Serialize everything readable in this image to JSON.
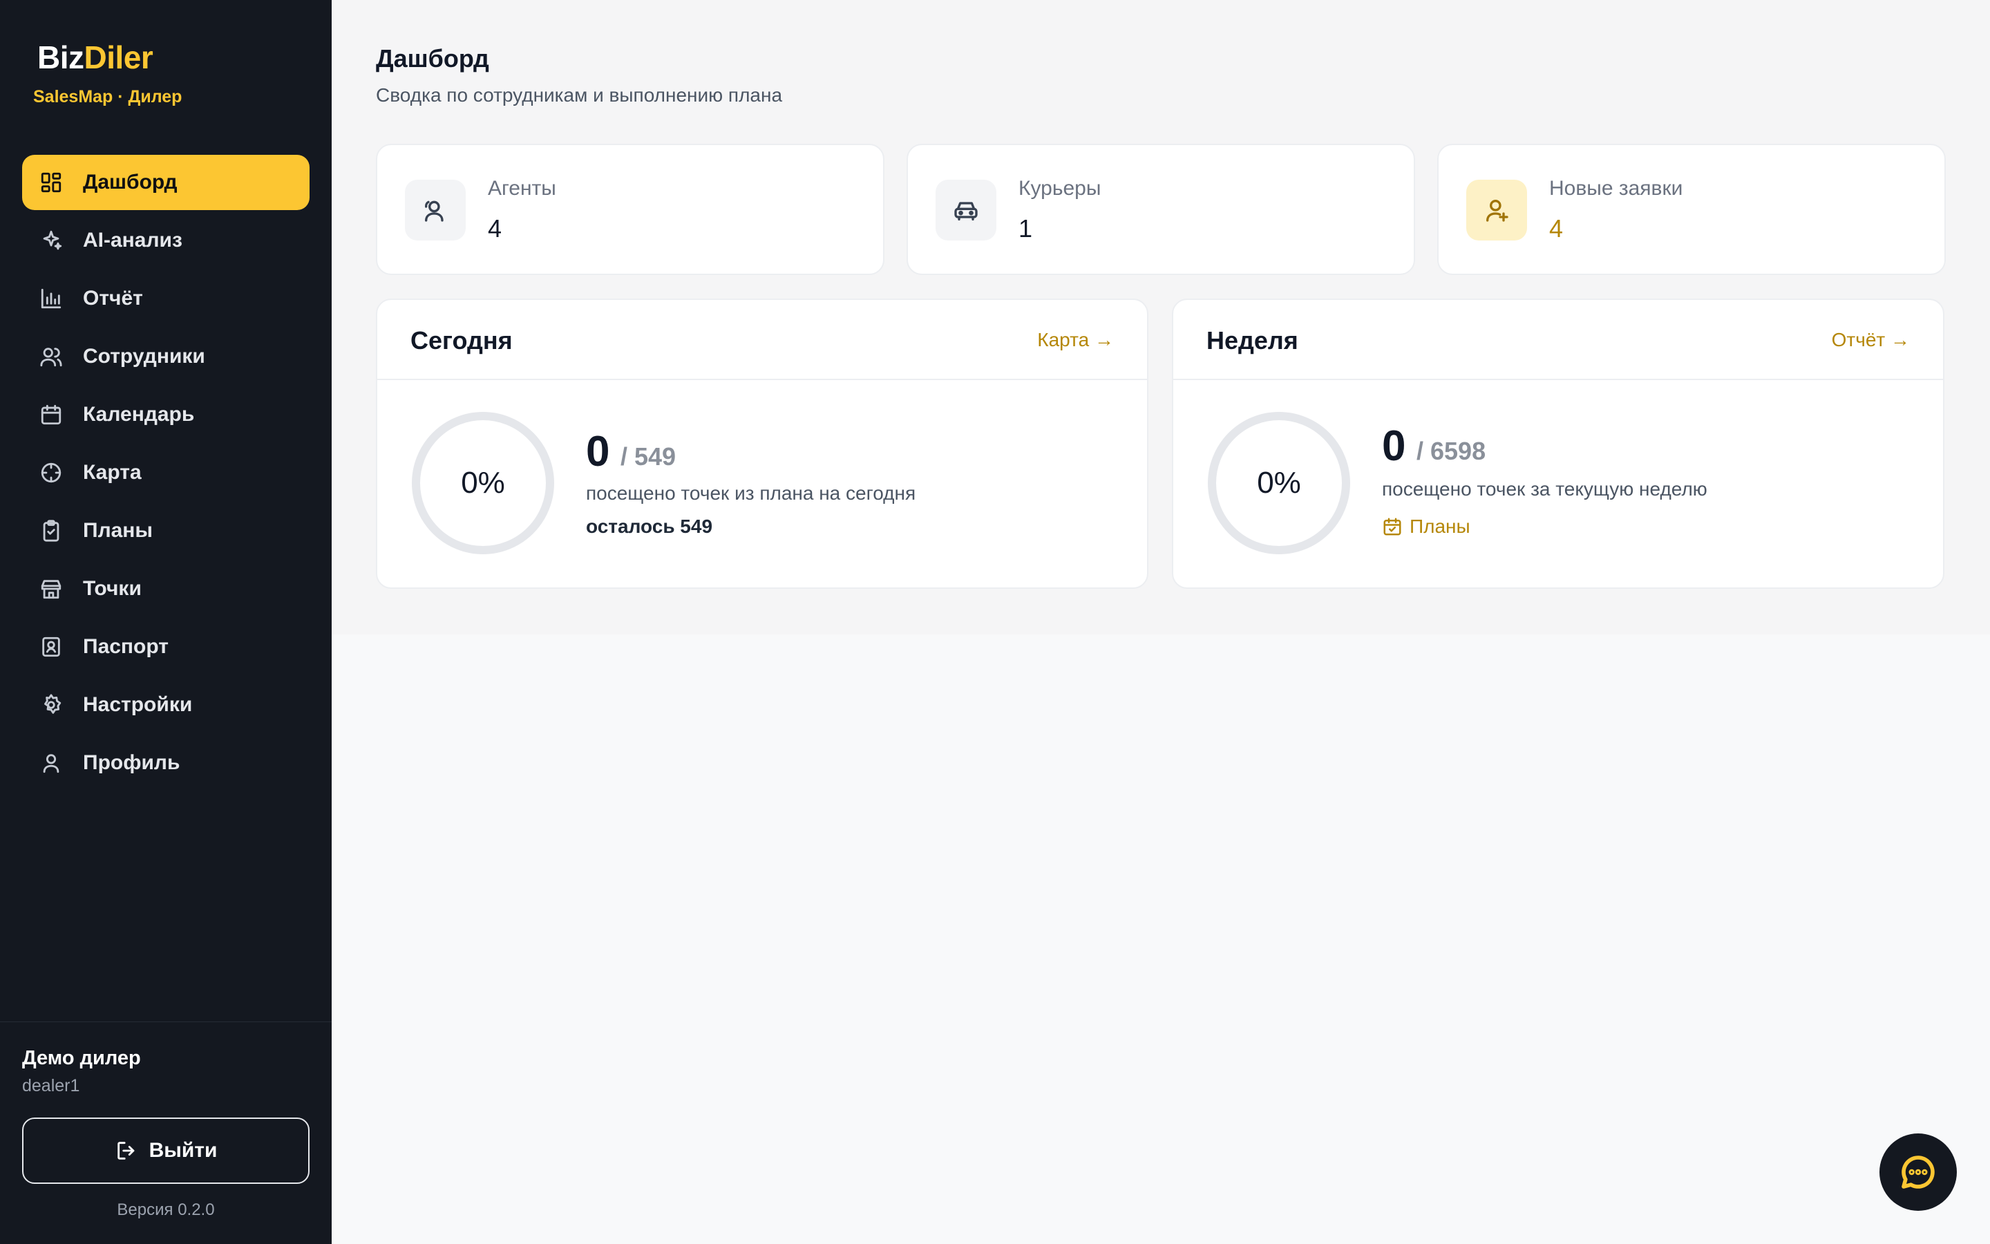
{
  "sidebar": {
    "brand_part1": "Biz",
    "brand_part2": "Diler",
    "brand_sub": "SalesMap · Дилер",
    "items": [
      {
        "label": "Дашборд",
        "icon": "dashboard-icon",
        "active": true
      },
      {
        "label": "AI-анализ",
        "icon": "sparkle-icon"
      },
      {
        "label": "Отчёт",
        "icon": "bar-chart-icon"
      },
      {
        "label": "Сотрудники",
        "icon": "users-icon"
      },
      {
        "label": "Календарь",
        "icon": "calendar-icon"
      },
      {
        "label": "Карта",
        "icon": "crosshair-icon"
      },
      {
        "label": "Планы",
        "icon": "clipboard-check-icon"
      },
      {
        "label": "Точки",
        "icon": "store-icon"
      },
      {
        "label": "Паспорт",
        "icon": "id-card-icon"
      },
      {
        "label": "Настройки",
        "icon": "gear-icon"
      },
      {
        "label": "Профиль",
        "icon": "user-icon"
      }
    ],
    "user_name": "Демо дилер",
    "user_login": "dealer1",
    "logout_label": "Выйти",
    "version": "Версия 0.2.0"
  },
  "header": {
    "title": "Дашборд",
    "subtitle": "Сводка по сотрудникам и выполнению плана"
  },
  "stats": [
    {
      "label": "Агенты",
      "value": "4",
      "icon": "agents-icon"
    },
    {
      "label": "Курьеры",
      "value": "1",
      "icon": "car-icon"
    },
    {
      "label": "Новые заявки",
      "value": "4",
      "icon": "user-plus-icon",
      "accent": "#b58708"
    }
  ],
  "today": {
    "title": "Сегодня",
    "link": "Карта →",
    "percent": "0%",
    "progress": 0,
    "visited": "0",
    "total": "/ 549",
    "desc": "посещено точек из плана на сегодня",
    "remaining": "осталось 549"
  },
  "week": {
    "title": "Неделя",
    "link": "Отчёт →",
    "percent": "0%",
    "progress": 0,
    "visited": "0",
    "total": "/ 6598",
    "desc": "посещено точек за текущую неделю",
    "plans_link": "Планы"
  },
  "colors": {
    "accent": "#fcc632",
    "accent_text": "#b58708",
    "sidebar_bg": "#141820"
  }
}
